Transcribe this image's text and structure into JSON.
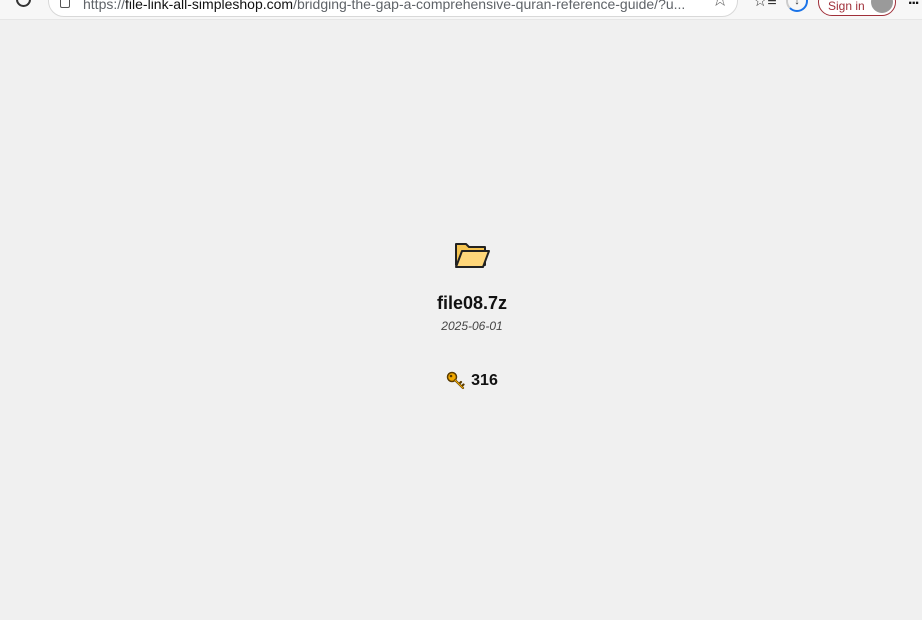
{
  "browser": {
    "url_prefix": "https://",
    "url_host": "file-link-all-simpleshop.com",
    "url_path": "/bridging-the-gap-a-comprehensive-quran-reference-guide/?u...",
    "signin_label": "Sign in",
    "menu_glyph": "..."
  },
  "file": {
    "icon": "open-folder-icon",
    "name": "file08.7z",
    "date": "2025-06-01",
    "key_icon": "key-icon",
    "key_count": "316"
  },
  "colors": {
    "background": "#f0f0f0",
    "folder_fill": "#f5c451",
    "key_fill": "#f2a900",
    "signin_accent": "#a0303a"
  }
}
